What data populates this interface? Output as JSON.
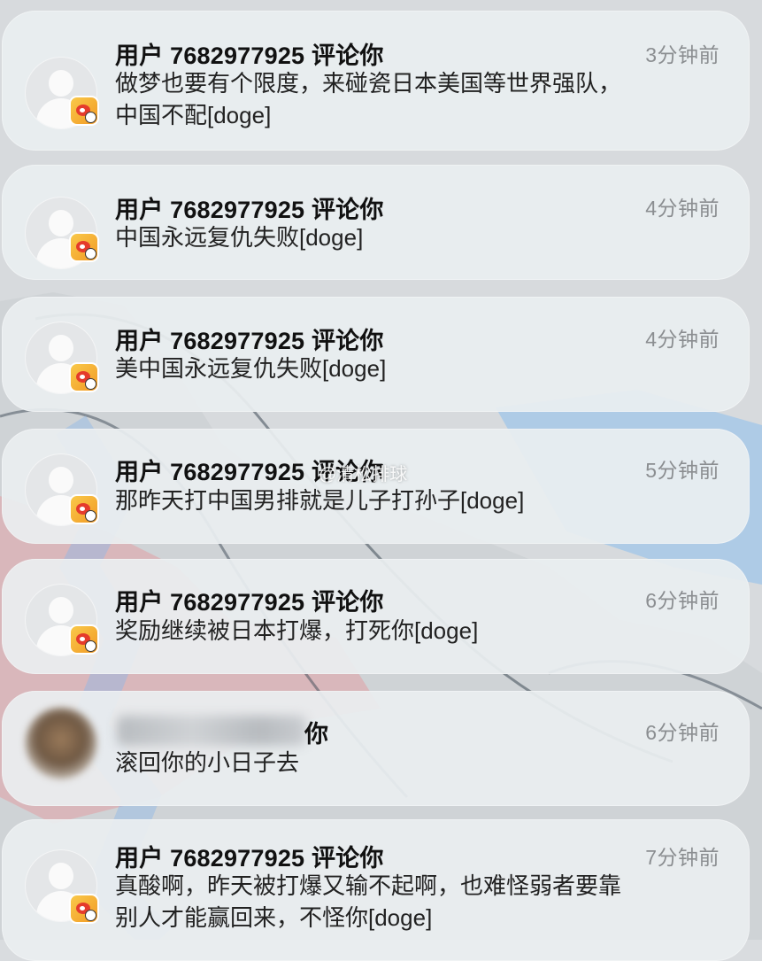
{
  "notifications": [
    {
      "title": "用户 7682977925 评论你",
      "time": "3分钟前",
      "lines": [
        "做梦也要有个限度，来碰瓷日本美国等世界强队，",
        "中国不配[doge]"
      ]
    },
    {
      "title": "用户 7682977925 评论你",
      "time": "4分钟前",
      "lines": [
        "中国永远复仇失败[doge]"
      ]
    },
    {
      "title": "用户 7682977925 评论你",
      "time": "4分钟前",
      "lines": [
        "美中国永远复仇失败[doge]"
      ]
    },
    {
      "title": "用户 7682977925 评论你",
      "time": "5分钟前",
      "lines": [
        "那昨天打中国男排就是儿子打孙子[doge]"
      ]
    },
    {
      "title": "用户 7682977925 评论你",
      "time": "6分钟前",
      "lines": [
        "奖励继续被日本打爆，打死你[doge]"
      ]
    },
    {
      "title_visible": "你",
      "time": "6分钟前",
      "lines": [
        "滚回你的小日子去"
      ]
    },
    {
      "title": "用户 7682977925 评论你",
      "time": "7分钟前",
      "lines": [
        "真酸啊，昨天被打爆又输不起啊，也难怪弱者要靠",
        "别人才能赢回来，不怪你[doge]"
      ]
    }
  ],
  "watermark": "@清松排球",
  "icons": {
    "avatar": "default-user-avatar-icon",
    "badge": "weibo-app-icon"
  }
}
